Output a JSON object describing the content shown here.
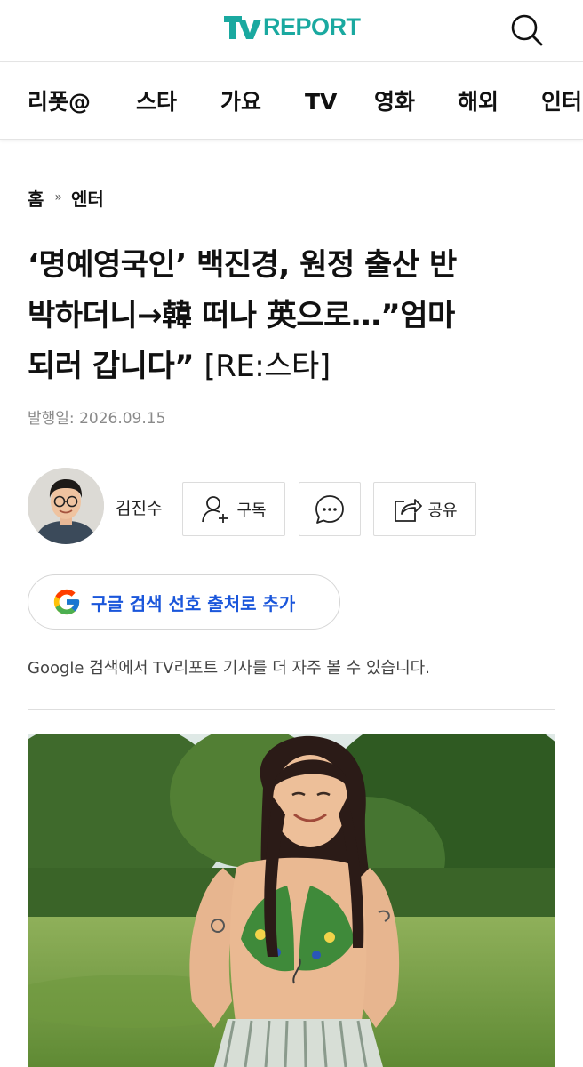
{
  "header": {
    "logo_text": "REPORT",
    "logo_mark": "tv-logo-icon",
    "brand_color": "#1aa9a0",
    "search_icon": "search-icon"
  },
  "nav": {
    "items": [
      {
        "label": "리폿@"
      },
      {
        "label": "스타"
      },
      {
        "label": "가요"
      },
      {
        "label": "TV"
      },
      {
        "label": "영화"
      },
      {
        "label": "해외"
      },
      {
        "label": "인터"
      }
    ]
  },
  "breadcrumb": {
    "home": "홈",
    "separator": "»",
    "section": "엔터"
  },
  "article": {
    "title_line1": "‘명예영국인’ 백진경, 원정 출산 반",
    "title_line2": "박하더니→韓 떠나 英으로…”엄마",
    "title_line3": "되러 갑니다”",
    "title_tag": "[RE:스타]",
    "date_label": "발행일:",
    "date_value": "2026.09.15"
  },
  "author": {
    "name": "김진수",
    "avatar_icon": "avatar"
  },
  "actions": {
    "subscribe_label": "구독",
    "more_icon": "more-dots-icon",
    "share_label": "공유"
  },
  "google": {
    "button_label": "구글 검색 선호 출처로 추가",
    "note": "Google 검색에서 TV리포트 기사를 더 자주 볼 수 있습니다."
  },
  "colors": {
    "link_blue": "#1a56db",
    "meta_gray": "#8a8a8a"
  }
}
